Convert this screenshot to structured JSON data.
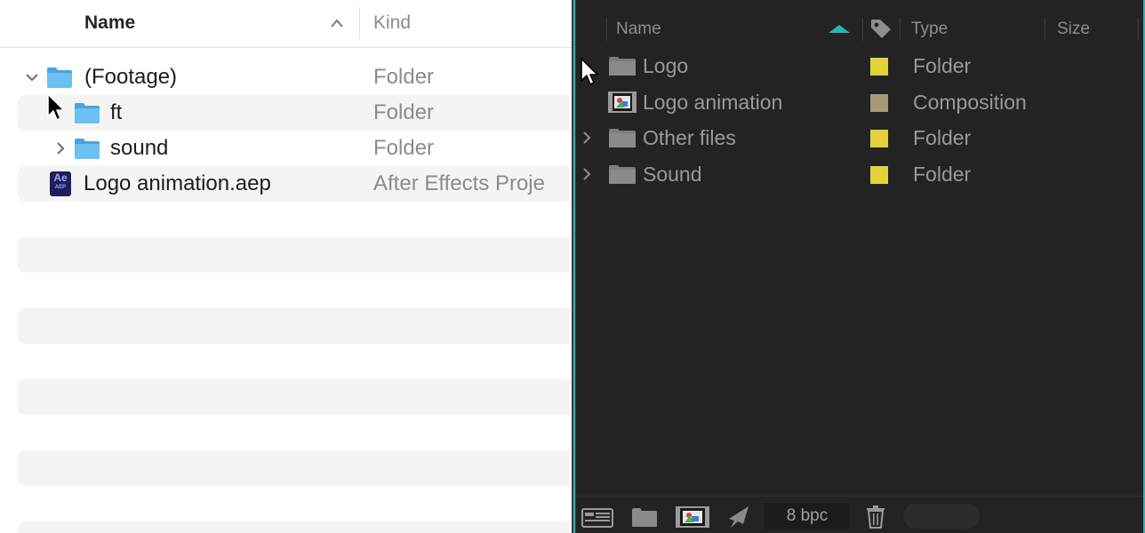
{
  "finder": {
    "columns": {
      "name": "Name",
      "kind": "Kind"
    },
    "rows": [
      {
        "name": "(Footage)",
        "kind": "Folder",
        "icon": "folder-icon",
        "disclosure": "expanded"
      },
      {
        "name": "ft",
        "kind": "Folder",
        "icon": "folder-icon",
        "disclosure": "none"
      },
      {
        "name": "sound",
        "kind": "Folder",
        "icon": "folder-icon",
        "disclosure": "collapsed"
      },
      {
        "name": "Logo animation.aep",
        "kind": "After Effects Proje",
        "icon": "after-effects-file-icon",
        "disclosure": "none"
      }
    ],
    "ae_icon_text": "Ae",
    "ae_icon_subtext": "AEP"
  },
  "ae_panel": {
    "columns": {
      "name": "Name",
      "type": "Type",
      "size": "Size"
    },
    "rows": [
      {
        "name": "Logo",
        "type": "Folder",
        "icon": "folder-icon",
        "label_color": "#e2d33c",
        "disclosure": "none"
      },
      {
        "name": "Logo animation",
        "type": "Composition",
        "icon": "composition-icon",
        "label_color": "#a89878",
        "disclosure": "none"
      },
      {
        "name": "Other files",
        "type": "Folder",
        "icon": "folder-icon",
        "label_color": "#e2d33c",
        "disclosure": "collapsed"
      },
      {
        "name": "Sound",
        "type": "Folder",
        "icon": "folder-icon",
        "label_color": "#e2d33c",
        "disclosure": "collapsed"
      }
    ],
    "footer": {
      "bit_depth": "8 bpc"
    }
  },
  "colors": {
    "accent": "#2bb3b1",
    "finder_folder": "#5ab4ec",
    "ae_background": "#232323"
  }
}
